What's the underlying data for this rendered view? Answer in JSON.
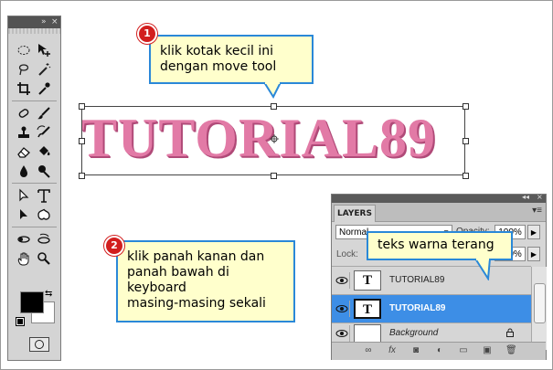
{
  "callout1": {
    "badge": "1",
    "line1": "klik kotak kecil ini",
    "line2": "dengan move tool"
  },
  "callout2": {
    "badge": "2",
    "line1": "klik panah kanan dan",
    "line2": "panah bawah di",
    "line3": "keyboard",
    "line4": "masing-masing sekali"
  },
  "callout3": {
    "text": "teks warna terang"
  },
  "canvas_text": "TUTORIAL89",
  "toolbox": {
    "titlebar_icons": [
      "collapse-arrows-icon",
      "close-icon"
    ],
    "tools": [
      "marquee-icon",
      "move-icon",
      "lasso-icon",
      "magic-wand-icon",
      "crop-icon",
      "eyedropper-icon",
      "healing-brush-icon",
      "brush-icon",
      "clone-stamp-icon",
      "history-brush-icon",
      "eraser-icon",
      "paint-bucket-icon",
      "blur-icon",
      "dodge-icon",
      "path-selection-icon",
      "type-icon",
      "direct-selection-icon",
      "custom-shape-icon",
      "3d-rotate-icon",
      "3d-orbit-icon",
      "hand-icon",
      "zoom-icon"
    ],
    "foreground_color": "#000000",
    "background_color": "#ffffff"
  },
  "layers_panel": {
    "tab": "LAYERS",
    "blend_mode": "Normal",
    "opacity_label": "Opacity:",
    "opacity_value": "100%",
    "lock_label": "Lock:",
    "fill_value": "100%",
    "layers": [
      {
        "name": "TUTORIAL89",
        "thumb": "T",
        "selected": false
      },
      {
        "name": "TUTORIAL89",
        "thumb": "T",
        "selected": true
      },
      {
        "name": "Background",
        "thumb": "",
        "selected": false,
        "locked": true
      }
    ]
  },
  "colors": {
    "callout_bg": "#ffffcc",
    "callout_border": "#2a88d8",
    "badge": "#d21e1e",
    "text_pink": "#e27aa6",
    "selection": "#3d8ee6"
  }
}
